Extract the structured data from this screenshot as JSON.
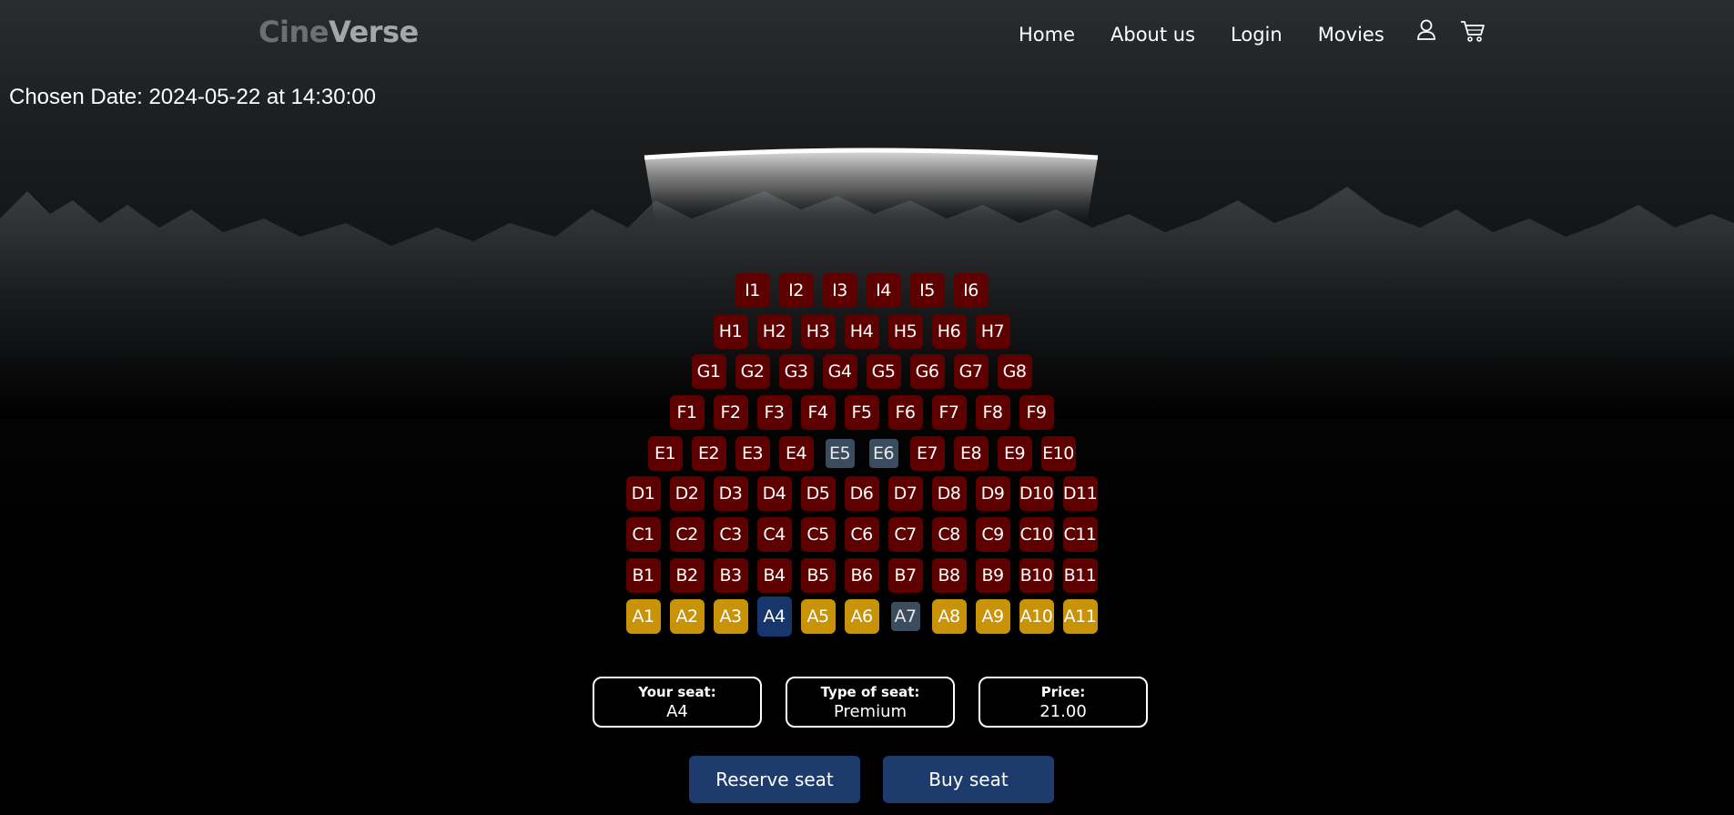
{
  "brand": {
    "part1": "Cine",
    "part2": "Verse"
  },
  "nav": {
    "home": "Home",
    "about": "About us",
    "login": "Login",
    "movies": "Movies"
  },
  "icons": {
    "user": "user-icon",
    "cart": "cart-icon"
  },
  "date": {
    "label": "Chosen Date:",
    "value": "2024-05-22 at 14:30:00"
  },
  "colors": {
    "standard_seat": "#5e0000",
    "premium_seat": "#c99308",
    "taken_seat": "#3b4c5f",
    "selected_seat": "#17376c",
    "button": "#1e3b6e"
  },
  "rows": [
    {
      "row": "I",
      "seats": [
        {
          "id": "I1",
          "status": "available"
        },
        {
          "id": "I2",
          "status": "available"
        },
        {
          "id": "I3",
          "status": "available"
        },
        {
          "id": "I4",
          "status": "available"
        },
        {
          "id": "I5",
          "status": "available"
        },
        {
          "id": "I6",
          "status": "available"
        }
      ]
    },
    {
      "row": "H",
      "seats": [
        {
          "id": "H1",
          "status": "available"
        },
        {
          "id": "H2",
          "status": "available"
        },
        {
          "id": "H3",
          "status": "available"
        },
        {
          "id": "H4",
          "status": "available"
        },
        {
          "id": "H5",
          "status": "available"
        },
        {
          "id": "H6",
          "status": "available"
        },
        {
          "id": "H7",
          "status": "available"
        }
      ]
    },
    {
      "row": "G",
      "seats": [
        {
          "id": "G1",
          "status": "available"
        },
        {
          "id": "G2",
          "status": "available"
        },
        {
          "id": "G3",
          "status": "available"
        },
        {
          "id": "G4",
          "status": "available"
        },
        {
          "id": "G5",
          "status": "available"
        },
        {
          "id": "G6",
          "status": "available"
        },
        {
          "id": "G7",
          "status": "available"
        },
        {
          "id": "G8",
          "status": "available"
        }
      ]
    },
    {
      "row": "F",
      "seats": [
        {
          "id": "F1",
          "status": "available"
        },
        {
          "id": "F2",
          "status": "available"
        },
        {
          "id": "F3",
          "status": "available"
        },
        {
          "id": "F4",
          "status": "available"
        },
        {
          "id": "F5",
          "status": "available"
        },
        {
          "id": "F6",
          "status": "available"
        },
        {
          "id": "F7",
          "status": "available"
        },
        {
          "id": "F8",
          "status": "available"
        },
        {
          "id": "F9",
          "status": "available"
        }
      ]
    },
    {
      "row": "E",
      "seats": [
        {
          "id": "E1",
          "status": "available"
        },
        {
          "id": "E2",
          "status": "available"
        },
        {
          "id": "E3",
          "status": "available"
        },
        {
          "id": "E4",
          "status": "available"
        },
        {
          "id": "E5",
          "status": "taken"
        },
        {
          "id": "E6",
          "status": "taken"
        },
        {
          "id": "E7",
          "status": "available"
        },
        {
          "id": "E8",
          "status": "available"
        },
        {
          "id": "E9",
          "status": "available"
        },
        {
          "id": "E10",
          "status": "available"
        }
      ]
    },
    {
      "row": "D",
      "seats": [
        {
          "id": "D1",
          "status": "available"
        },
        {
          "id": "D2",
          "status": "available"
        },
        {
          "id": "D3",
          "status": "available"
        },
        {
          "id": "D4",
          "status": "available"
        },
        {
          "id": "D5",
          "status": "available"
        },
        {
          "id": "D6",
          "status": "available"
        },
        {
          "id": "D7",
          "status": "available"
        },
        {
          "id": "D8",
          "status": "available"
        },
        {
          "id": "D9",
          "status": "available"
        },
        {
          "id": "D10",
          "status": "available"
        },
        {
          "id": "D11",
          "status": "available"
        }
      ]
    },
    {
      "row": "C",
      "seats": [
        {
          "id": "C1",
          "status": "available"
        },
        {
          "id": "C2",
          "status": "available"
        },
        {
          "id": "C3",
          "status": "available"
        },
        {
          "id": "C4",
          "status": "available"
        },
        {
          "id": "C5",
          "status": "available"
        },
        {
          "id": "C6",
          "status": "available"
        },
        {
          "id": "C7",
          "status": "available"
        },
        {
          "id": "C8",
          "status": "available"
        },
        {
          "id": "C9",
          "status": "available"
        },
        {
          "id": "C10",
          "status": "available"
        },
        {
          "id": "C11",
          "status": "available"
        }
      ]
    },
    {
      "row": "B",
      "seats": [
        {
          "id": "B1",
          "status": "available"
        },
        {
          "id": "B2",
          "status": "available"
        },
        {
          "id": "B3",
          "status": "available"
        },
        {
          "id": "B4",
          "status": "available"
        },
        {
          "id": "B5",
          "status": "available"
        },
        {
          "id": "B6",
          "status": "available"
        },
        {
          "id": "B7",
          "status": "available"
        },
        {
          "id": "B8",
          "status": "available"
        },
        {
          "id": "B9",
          "status": "available"
        },
        {
          "id": "B10",
          "status": "available"
        },
        {
          "id": "B11",
          "status": "available"
        }
      ]
    },
    {
      "row": "A",
      "seats": [
        {
          "id": "A1",
          "status": "premium"
        },
        {
          "id": "A2",
          "status": "premium"
        },
        {
          "id": "A3",
          "status": "premium"
        },
        {
          "id": "A4",
          "status": "selected"
        },
        {
          "id": "A5",
          "status": "premium"
        },
        {
          "id": "A6",
          "status": "premium"
        },
        {
          "id": "A7",
          "status": "taken"
        },
        {
          "id": "A8",
          "status": "premium"
        },
        {
          "id": "A9",
          "status": "premium"
        },
        {
          "id": "A10",
          "status": "premium"
        },
        {
          "id": "A11",
          "status": "premium"
        }
      ]
    }
  ],
  "info": {
    "seat_label": "Your seat:",
    "seat_value": "A4",
    "type_label": "Type of seat:",
    "type_value": "Premium",
    "price_label": "Price:",
    "price_value": "21.00"
  },
  "actions": {
    "reserve": "Reserve seat",
    "buy": "Buy seat"
  }
}
